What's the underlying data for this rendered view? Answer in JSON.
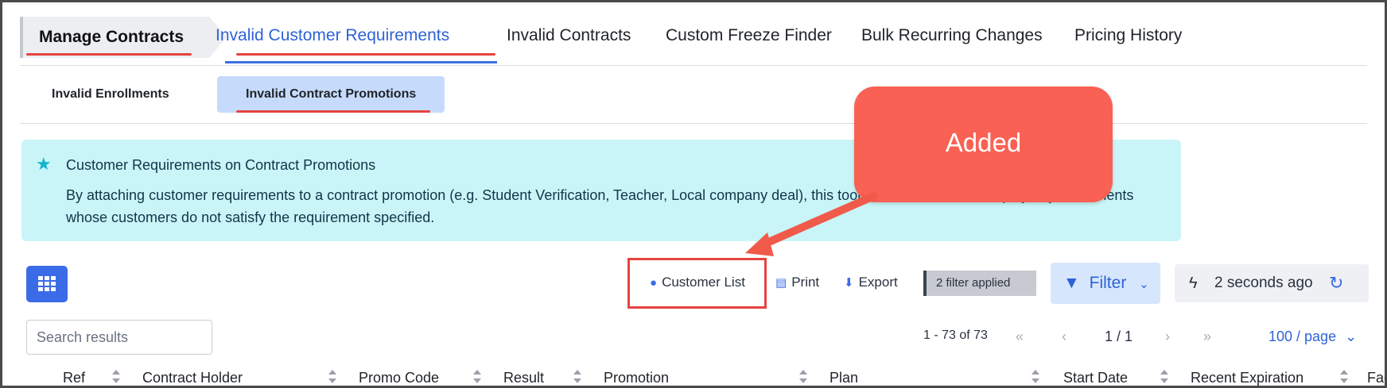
{
  "breadcrumb": {
    "label": "Manage Contracts"
  },
  "top_tabs": [
    {
      "label": "Invalid Customer Requirements",
      "active": true
    },
    {
      "label": "Invalid Contracts"
    },
    {
      "label": "Custom Freeze Finder"
    },
    {
      "label": "Bulk Recurring Changes"
    },
    {
      "label": "Pricing History"
    }
  ],
  "sub_tabs": [
    {
      "label": "Invalid Enrollments"
    },
    {
      "label": "Invalid Contract Promotions",
      "active": true
    }
  ],
  "alert": {
    "title": "Customer Requirements on Contract Promotions",
    "body": "By attaching customer requirements to a contract promotion (e.g. Student Verification, Teacher, Local company deal), this tool will search for and display any enrollments whose customers do not satisfy the requirement specified."
  },
  "callout": {
    "text": "Added"
  },
  "toolbar": {
    "customer_list": "Customer List",
    "print": "Print",
    "export": "Export",
    "filter_applied": "2 filter applied",
    "filter": "Filter",
    "last_refreshed": "2 seconds ago"
  },
  "search": {
    "placeholder": "Search results"
  },
  "pagination": {
    "range": "1 - 73 of 73",
    "page": "1 / 1",
    "per_page": "100 / page"
  },
  "table": {
    "columns": [
      "Ref",
      "Contract Holder",
      "Promo Code",
      "Result",
      "Promotion",
      "Plan",
      "Start Date",
      "Recent Expiration",
      "Fac"
    ]
  },
  "colors": {
    "accent": "#3b6be6",
    "active_tab": "#2f62d6",
    "annotation_red": "#e5433f",
    "callout": "#f96154",
    "alert_bg": "#c9f5f8"
  }
}
